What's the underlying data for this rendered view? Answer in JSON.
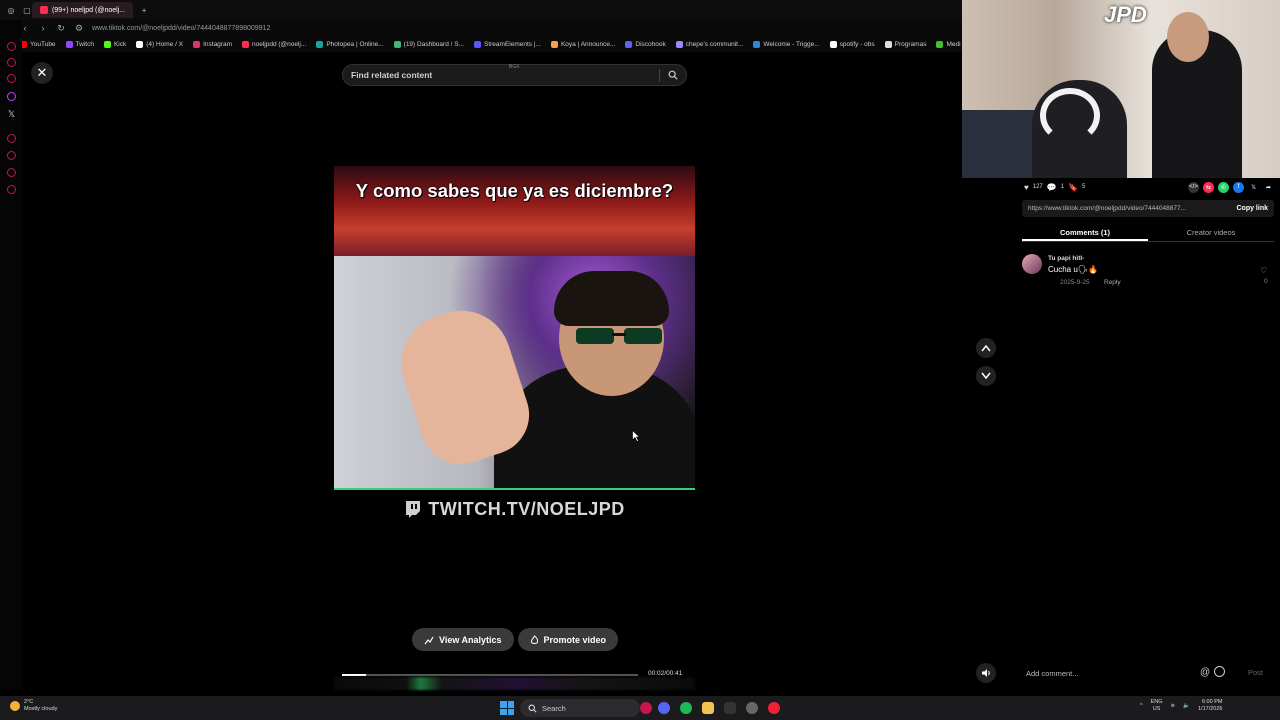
{
  "browser": {
    "tab_title": "(99+) noeljpd (@noelj...",
    "url": "www.tiktok.com/@noeljpdd/video/7444048877898009912",
    "bookmarks": [
      {
        "label": "YouTube",
        "color": "#ff0000"
      },
      {
        "label": "Twitch",
        "color": "#9146ff"
      },
      {
        "label": "Kick",
        "color": "#53fc18"
      },
      {
        "label": "(4) Home / X",
        "color": "#ffffff"
      },
      {
        "label": "Instagram",
        "color": "#e1306c"
      },
      {
        "label": "noeljpdd (@noelj...",
        "color": "#fe2c55"
      },
      {
        "label": "Photopea | Online...",
        "color": "#18a497"
      },
      {
        "label": "(19) Dashboard / S...",
        "color": "#3cb878"
      },
      {
        "label": "StreamElements |...",
        "color": "#5a55ff"
      },
      {
        "label": "Koya | Announce...",
        "color": "#ff9f43"
      },
      {
        "label": "Discohook",
        "color": "#5865f2"
      },
      {
        "label": "chepe's communit...",
        "color": "#9c88ff"
      },
      {
        "label": "Welcome - Trigge...",
        "color": "#2e86de"
      },
      {
        "label": "spotify - obs",
        "color": "#ffffff"
      },
      {
        "label": "Programas",
        "color": "#dddddd"
      },
      {
        "label": "Medi",
        "color": "#44bd32"
      }
    ]
  },
  "video": {
    "search_placeholder": "Find related content",
    "mini_label": "BGX",
    "caption": "Y como sabes que ya es diciembre?",
    "twitch_banner": "TWITCH.TV/NOELJPD",
    "view_analytics": "View Analytics",
    "promote_video": "Promote video",
    "time": "00:02/00:41",
    "progress": 0.08
  },
  "webcam": {
    "logo": "JPD"
  },
  "panel": {
    "likes": "127",
    "comments_count": "1",
    "saves": "5",
    "link": "https://www.tiktok.com/@noeljpdd/video/7444048877...",
    "copy_link": "Copy link",
    "tab_comments": "Comments (1)",
    "tab_creator": "Creator videos",
    "comment": {
      "user": "Tu papi hitl-",
      "text": "Cucha u🗣🔥",
      "date": "2025-9-25",
      "reply": "Reply",
      "likes": "0"
    },
    "add_comment": "Add comment...",
    "post": "Post"
  },
  "taskbar": {
    "weather_temp": "2°C",
    "weather_desc": "Mostly cloudy",
    "search": "Search",
    "lang": "ENG",
    "region": "US",
    "time": "6:00 PM",
    "date": "1/17/2026"
  }
}
